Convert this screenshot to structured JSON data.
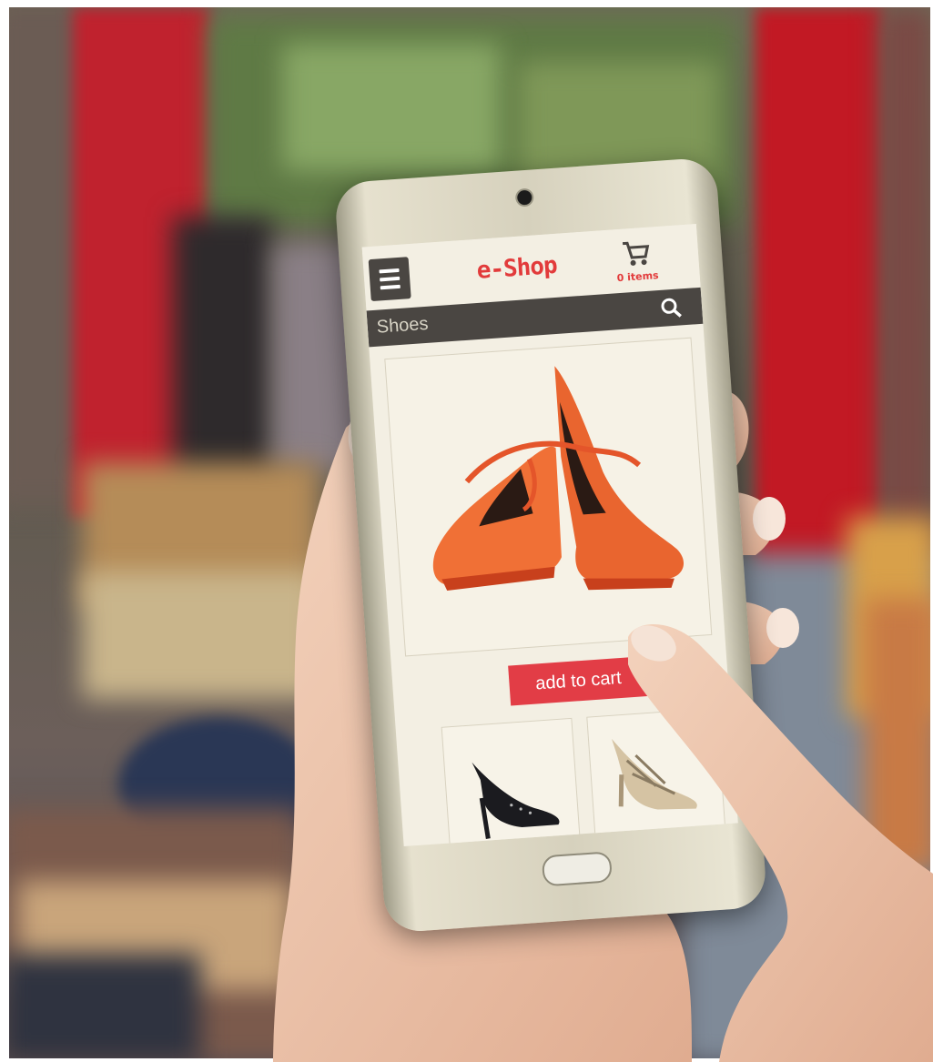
{
  "app": {
    "brand": "e-Shop",
    "cart_count": "0 items",
    "search_value": "Shoes",
    "add_to_cart_label": "add to cart"
  },
  "colors": {
    "accent": "#e23b3b",
    "toolbar": "#4a4642",
    "screen_bg": "#f3efe3"
  },
  "icons": [
    "menu-icon",
    "cart-icon",
    "search-icon"
  ],
  "products": {
    "featured": "orange-platform-heels",
    "thumbnails": [
      "black-studded-pump",
      "beige-strappy-sandal"
    ]
  }
}
